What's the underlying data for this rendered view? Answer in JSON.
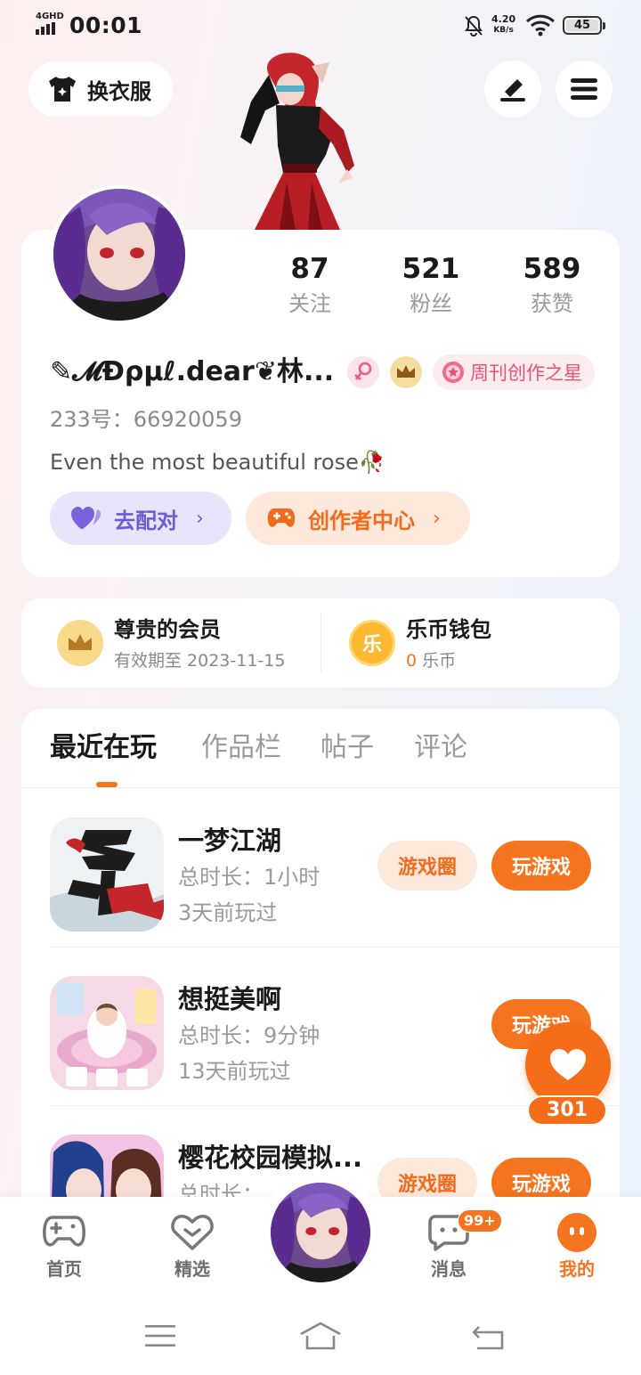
{
  "status": {
    "network": "4GHD",
    "time": "00:01",
    "speed_value": "4.20",
    "speed_unit": "KB/s",
    "battery": "45"
  },
  "header": {
    "outfit_label": "换衣服",
    "edit_icon": "pen-icon",
    "menu_icon": "hamburger-menu-icon"
  },
  "stats": [
    {
      "value": "87",
      "label": "关注"
    },
    {
      "value": "521",
      "label": "粉丝"
    },
    {
      "value": "589",
      "label": "获赞"
    }
  ],
  "profile": {
    "nickname": "✎𝓜Ɖρµℓ.dear❦林...",
    "star_badge": "周刊创作之星",
    "uid": "233号：66920059",
    "bio": "Even the most beautiful rose🥀",
    "match_label": "去配对",
    "creator_label": "创作者中心"
  },
  "membership": {
    "title": "尊贵的会员",
    "expiry": "有效期至 2023-11-15",
    "wallet_title": "乐币钱包",
    "coin_glyph": "乐",
    "coin_amount": "0",
    "coin_unit": "乐币"
  },
  "tabs": [
    "最近在玩",
    "作品栏",
    "帖子",
    "评论"
  ],
  "games": [
    {
      "name": "一梦江湖",
      "duration": "总时长：1小时",
      "last_played": "3天前玩过",
      "circle_label": "游戏圈",
      "play_label": "玩游戏"
    },
    {
      "name": "想挺美啊",
      "duration": "总时长：9分钟",
      "last_played": "13天前玩过",
      "play_label": "玩游戏"
    },
    {
      "name": "樱花校园模拟...",
      "duration": "总时长：",
      "circle_label": "游戏圈",
      "play_label": "玩游戏"
    }
  ],
  "like": {
    "count": "301"
  },
  "bottom_nav": {
    "home": "首页",
    "featured": "精选",
    "messages": "消息",
    "messages_badge": "99+",
    "mine": "我的"
  },
  "colors": {
    "accent": "#f5741f",
    "match_bg": "#e8e5fb",
    "match_text": "#6e5ad6",
    "creator_bg": "#fde9dc",
    "star_text": "#e8527a"
  }
}
